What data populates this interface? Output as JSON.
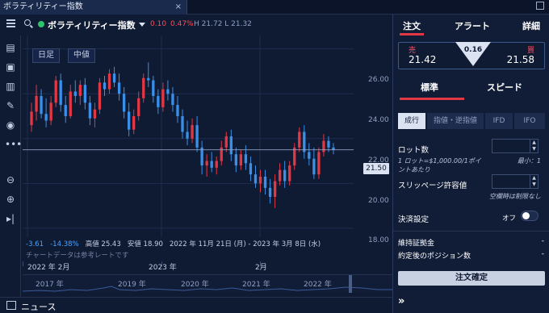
{
  "window": {
    "tab_title": "ボラティリティー指数",
    "close_glyph": "×"
  },
  "chart_header": {
    "instrument": "ボラティリティー指数",
    "change": "0.10",
    "change_pct": "0.47%",
    "high_low": "H 21.72 L 21.32",
    "status_color": "#2ec46b"
  },
  "chart_controls": {
    "period": "日足",
    "price_type": "中値"
  },
  "y_axis": {
    "ticks": [
      "26.00",
      "24.00",
      "22.00",
      "20.00",
      "18.00"
    ],
    "current_price": "21.50"
  },
  "stats": {
    "change": "-3.61",
    "change_pct": "-14.38%",
    "high": "高値 25.43",
    "low": "安値 18.90",
    "range": "2022 年 11月 21日 (月) - 2023 年 3月 8日 (水)",
    "note": "チャートデータは参考レートです"
  },
  "x_axis": {
    "labels": [
      "2022 年 2月",
      "2023 年",
      "2月"
    ]
  },
  "navigator": {
    "years": [
      "2017 年",
      "2019 年",
      "2020 年",
      "2021 年",
      "2022 年"
    ]
  },
  "bottom": {
    "news_label": "ニュース"
  },
  "order_panel": {
    "tabs": [
      "注文",
      "アラート",
      "詳細"
    ],
    "sell_label": "売",
    "sell_price": "21.42",
    "buy_label": "買",
    "buy_price": "21.58",
    "spread": "0.16",
    "mode_tabs": [
      "標準",
      "スピード"
    ],
    "order_types": [
      "成行",
      "指値・逆指値",
      "IFD",
      "IFO"
    ],
    "lot_label": "ロット数",
    "lot_desc": "1 ロット=$1,000.00/1ポイントあたり",
    "lot_min": "最小：1",
    "slippage_label": "スリッページ許容値",
    "slippage_note": "空欄時は制限なし",
    "settlement_label": "決済設定",
    "toggle_state": "オフ",
    "margin_label": "維持証拠金",
    "margin_value": "-",
    "position_label": "約定後のポジション数",
    "position_value": "-",
    "confirm_label": "注文確定",
    "expand_glyph": "»"
  },
  "chart_data": {
    "type": "candlestick",
    "up_color": "#e33744",
    "down_color": "#3a8fe8",
    "ylim": [
      17.6,
      26.6
    ],
    "candles": [
      {
        "o": 22.6,
        "h": 23.6,
        "l": 22.3,
        "c": 23.2
      },
      {
        "o": 23.2,
        "h": 24.4,
        "l": 22.8,
        "c": 23.9
      },
      {
        "o": 23.9,
        "h": 24.2,
        "l": 22.9,
        "c": 23.1
      },
      {
        "o": 23.1,
        "h": 23.8,
        "l": 22.5,
        "c": 22.8
      },
      {
        "o": 22.8,
        "h": 23.9,
        "l": 22.6,
        "c": 23.6
      },
      {
        "o": 23.6,
        "h": 24.8,
        "l": 23.4,
        "c": 24.6
      },
      {
        "o": 24.6,
        "h": 24.9,
        "l": 23.2,
        "c": 23.5
      },
      {
        "o": 23.5,
        "h": 23.9,
        "l": 22.7,
        "c": 23.0
      },
      {
        "o": 23.0,
        "h": 24.4,
        "l": 22.9,
        "c": 24.1
      },
      {
        "o": 24.1,
        "h": 24.6,
        "l": 23.6,
        "c": 23.9
      },
      {
        "o": 23.9,
        "h": 24.6,
        "l": 23.5,
        "c": 24.4
      },
      {
        "o": 24.4,
        "h": 24.7,
        "l": 23.3,
        "c": 23.6
      },
      {
        "o": 23.6,
        "h": 23.9,
        "l": 22.6,
        "c": 22.9
      },
      {
        "o": 22.9,
        "h": 23.6,
        "l": 22.5,
        "c": 23.3
      },
      {
        "o": 23.3,
        "h": 24.7,
        "l": 23.1,
        "c": 24.5
      },
      {
        "o": 24.5,
        "h": 24.8,
        "l": 23.9,
        "c": 24.2
      },
      {
        "o": 24.2,
        "h": 25.1,
        "l": 24.0,
        "c": 24.9
      },
      {
        "o": 24.9,
        "h": 25.2,
        "l": 24.3,
        "c": 24.5
      },
      {
        "o": 24.5,
        "h": 24.9,
        "l": 23.7,
        "c": 24.0
      },
      {
        "o": 24.0,
        "h": 24.3,
        "l": 22.9,
        "c": 23.2
      },
      {
        "o": 23.2,
        "h": 23.6,
        "l": 22.1,
        "c": 22.4
      },
      {
        "o": 22.4,
        "h": 23.3,
        "l": 22.2,
        "c": 23.0
      },
      {
        "o": 23.0,
        "h": 24.1,
        "l": 22.8,
        "c": 23.8
      },
      {
        "o": 23.8,
        "h": 24.9,
        "l": 23.6,
        "c": 24.7
      },
      {
        "o": 24.7,
        "h": 25.4,
        "l": 24.3,
        "c": 24.6
      },
      {
        "o": 24.6,
        "h": 24.8,
        "l": 23.6,
        "c": 23.9
      },
      {
        "o": 23.9,
        "h": 24.2,
        "l": 23.1,
        "c": 23.4
      },
      {
        "o": 23.4,
        "h": 24.5,
        "l": 23.2,
        "c": 24.2
      },
      {
        "o": 24.2,
        "h": 24.6,
        "l": 23.7,
        "c": 24.0
      },
      {
        "o": 24.0,
        "h": 24.3,
        "l": 23.2,
        "c": 23.5
      },
      {
        "o": 23.5,
        "h": 23.9,
        "l": 22.7,
        "c": 23.0
      },
      {
        "o": 23.0,
        "h": 23.3,
        "l": 22.0,
        "c": 22.3
      },
      {
        "o": 22.3,
        "h": 22.8,
        "l": 21.7,
        "c": 22.0
      },
      {
        "o": 22.0,
        "h": 22.9,
        "l": 21.8,
        "c": 22.6
      },
      {
        "o": 22.6,
        "h": 23.0,
        "l": 21.4,
        "c": 21.6
      },
      {
        "o": 21.6,
        "h": 21.9,
        "l": 20.4,
        "c": 20.8
      },
      {
        "o": 20.8,
        "h": 21.3,
        "l": 20.3,
        "c": 21.0
      },
      {
        "o": 21.0,
        "h": 21.4,
        "l": 20.5,
        "c": 20.7
      },
      {
        "o": 20.7,
        "h": 21.2,
        "l": 20.4,
        "c": 21.0
      },
      {
        "o": 21.0,
        "h": 21.9,
        "l": 20.8,
        "c": 21.6
      },
      {
        "o": 21.6,
        "h": 22.3,
        "l": 21.4,
        "c": 22.1
      },
      {
        "o": 22.1,
        "h": 22.4,
        "l": 21.0,
        "c": 21.3
      },
      {
        "o": 21.3,
        "h": 21.6,
        "l": 20.5,
        "c": 20.8
      },
      {
        "o": 20.8,
        "h": 21.5,
        "l": 20.6,
        "c": 21.3
      },
      {
        "o": 21.3,
        "h": 21.7,
        "l": 20.6,
        "c": 20.9
      },
      {
        "o": 20.9,
        "h": 21.2,
        "l": 20.1,
        "c": 20.4
      },
      {
        "o": 20.4,
        "h": 20.8,
        "l": 19.8,
        "c": 20.0
      },
      {
        "o": 20.0,
        "h": 20.6,
        "l": 19.6,
        "c": 20.3
      },
      {
        "o": 20.3,
        "h": 20.6,
        "l": 19.5,
        "c": 19.8
      },
      {
        "o": 19.8,
        "h": 20.2,
        "l": 19.1,
        "c": 19.4
      },
      {
        "o": 19.4,
        "h": 20.4,
        "l": 18.9,
        "c": 20.1
      },
      {
        "o": 20.1,
        "h": 20.9,
        "l": 19.9,
        "c": 20.6
      },
      {
        "o": 20.6,
        "h": 21.0,
        "l": 19.8,
        "c": 20.1
      },
      {
        "o": 20.1,
        "h": 21.0,
        "l": 19.9,
        "c": 20.8
      },
      {
        "o": 20.8,
        "h": 21.8,
        "l": 20.6,
        "c": 21.6
      },
      {
        "o": 21.6,
        "h": 22.5,
        "l": 21.4,
        "c": 22.3
      },
      {
        "o": 22.3,
        "h": 22.6,
        "l": 21.1,
        "c": 21.4
      },
      {
        "o": 21.4,
        "h": 21.8,
        "l": 20.8,
        "c": 21.1
      },
      {
        "o": 21.1,
        "h": 21.6,
        "l": 20.2,
        "c": 20.4
      },
      {
        "o": 20.4,
        "h": 21.6,
        "l": 20.2,
        "c": 21.4
      },
      {
        "o": 21.4,
        "h": 22.2,
        "l": 21.2,
        "c": 21.9
      },
      {
        "o": 21.9,
        "h": 22.1,
        "l": 21.4,
        "c": 21.6
      },
      {
        "o": 21.6,
        "h": 21.8,
        "l": 21.3,
        "c": 21.5
      }
    ]
  }
}
